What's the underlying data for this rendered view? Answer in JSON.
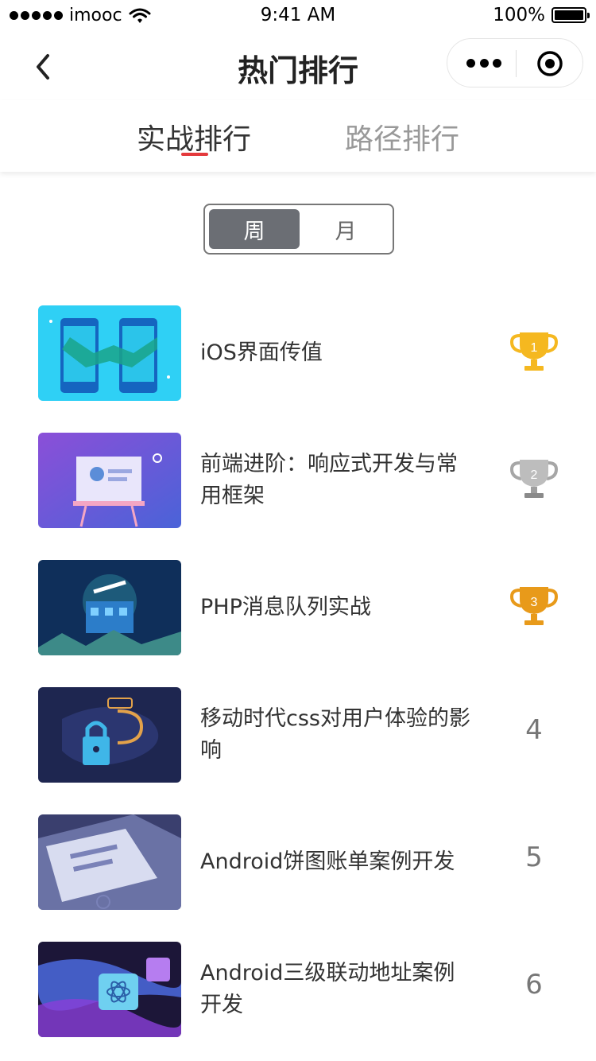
{
  "status_bar": {
    "carrier": "imooc",
    "time": "9:41 AM",
    "battery": "100%"
  },
  "nav": {
    "title": "热门排行"
  },
  "tabs": [
    {
      "label": "实战排行",
      "active": true
    },
    {
      "label": "路径排行",
      "active": false
    }
  ],
  "period_toggle": {
    "options": [
      "周",
      "月"
    ],
    "selected": "周"
  },
  "ranking": [
    {
      "rank": 1,
      "title": "iOS界面传值",
      "trophy": "gold"
    },
    {
      "rank": 2,
      "title": "前端进阶：响应式开发与常用框架",
      "trophy": "silver"
    },
    {
      "rank": 3,
      "title": "PHP消息队列实战",
      "trophy": "bronze"
    },
    {
      "rank": 4,
      "title": "移动时代css对用户体验的影响"
    },
    {
      "rank": 5,
      "title": "Android饼图账单案例开发"
    },
    {
      "rank": 6,
      "title": "Android三级联动地址案例开发"
    }
  ],
  "colors": {
    "tab_indicator": "#e4393c",
    "toggle_selected_bg": "#6b6e74",
    "gold": "#f5b820",
    "silver": "#a6a6a6",
    "bronze": "#e89a1a"
  },
  "icons": {
    "back": "chevron-left-icon",
    "more": "more-dots-icon",
    "close_target": "target-icon",
    "signal": "signal-dots-icon",
    "wifi": "wifi-icon",
    "battery": "battery-icon",
    "trophy": "trophy-icon"
  }
}
